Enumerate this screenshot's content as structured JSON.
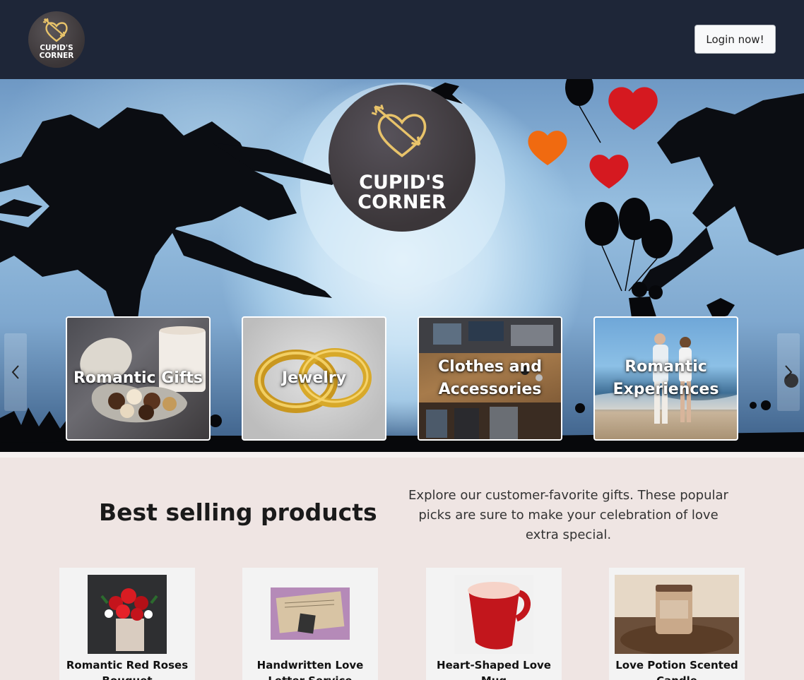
{
  "brand": {
    "logo_line1": "CUPID'S",
    "logo_line2": "CORNER"
  },
  "navbar": {
    "login_label": "Login now!"
  },
  "hero": {
    "categories": [
      {
        "label": "Romantic Gifts"
      },
      {
        "label": "Jewelry"
      },
      {
        "label": "Clothes and Accessories"
      },
      {
        "label": "Romantic Experiences"
      }
    ]
  },
  "best_sellers": {
    "title": "Best selling products",
    "description": "Explore our customer-favorite gifts. These popular picks are sure to make your celebration of love extra special.",
    "products": [
      {
        "name": "Romantic Red Roses Bouquet"
      },
      {
        "name": "Handwritten Love Letter Service"
      },
      {
        "name": "Heart-Shaped Love Mug"
      },
      {
        "name": "Love Potion Scented Candle"
      }
    ]
  },
  "colors": {
    "navbar_bg": "#1e2638",
    "page_bg": "#efe5e3",
    "logo_gold": "#e8c36a",
    "heart_red": "#d51920",
    "heart_orange": "#f06a10"
  },
  "icons": [
    "heart-arrow-icon",
    "chevron-left-icon",
    "chevron-right-icon"
  ]
}
